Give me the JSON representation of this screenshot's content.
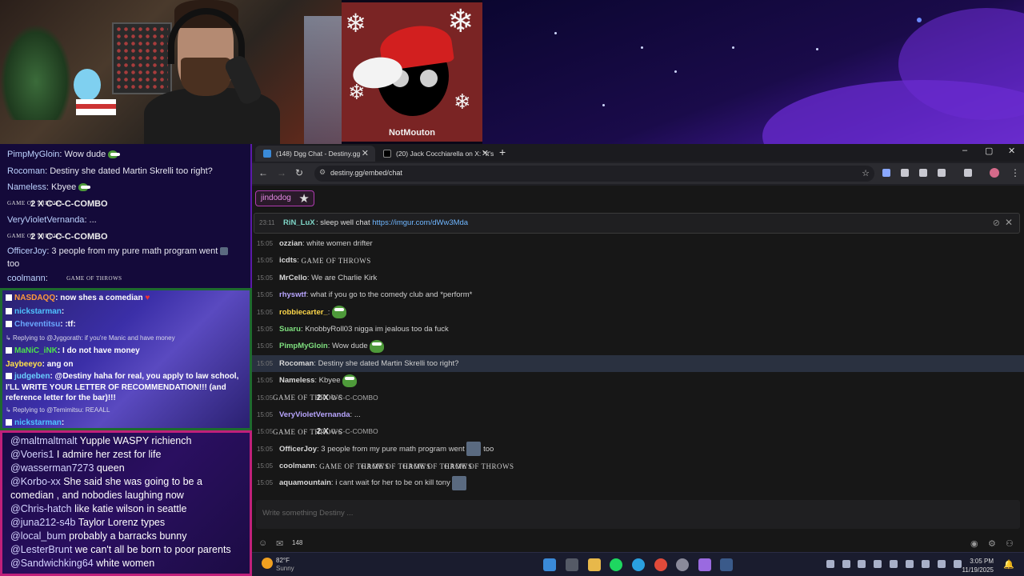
{
  "stream": {
    "xmas_label": "NotMouton"
  },
  "dgg_overlay": {
    "lines": [
      {
        "user": "PimpMyGloin",
        "text": ": Wow dude"
      },
      {
        "user": "Rocoman",
        "text": ": Destiny she dated Martin Skrelli too right?"
      },
      {
        "user": "Nameless",
        "text": ": Kbyee"
      },
      {
        "combo": "2 X C-C-C-COMBO"
      },
      {
        "user": "VeryVioletVernanda",
        "text": ": ..."
      },
      {
        "combo": "2 X C-C-C-COMBO"
      },
      {
        "user": "OfficerJoy",
        "text": ": 3 people from my pure math program went",
        "tail": "too"
      },
      {
        "user": "coolmann",
        "text": ":"
      }
    ],
    "got_emote": "GAME OF THROWS"
  },
  "twitch_overlay": {
    "lines": [
      {
        "user": "NASDAQQ",
        "text": ": now shes a comedian",
        "color": "#ff9a3a"
      },
      {
        "user": "nickstarman",
        "text": ":",
        "color": "#4fc3ff"
      },
      {
        "user": "Cheventitsu",
        "text": ": :tf:",
        "color": "#6aa8ff"
      },
      {
        "reply": "Replying to @Jyggorath: if you're Manic and have money"
      },
      {
        "user": "MaNiC_iNK",
        "text": ": I do not have money",
        "color": "#4ce04c"
      },
      {
        "user": "Jaybeeyo",
        "text": ": ang on",
        "color": "#ffe04a"
      },
      {
        "user": "judgeben",
        "text": ": @Destiny haha for real, you apply to law school, I'LL WRITE YOUR LETTER OF RECOMMENDATION!!! (and reference letter for the bar)!!!",
        "color": "#6ad0ff"
      },
      {
        "reply": "Replying to @Temimitsu: REAALL"
      },
      {
        "user": "nickstarman",
        "text": ":",
        "color": "#4fc3ff"
      }
    ]
  },
  "yt_overlay": {
    "lines": [
      {
        "user": "@maltmaltmalt",
        "text": "Yupple WASPY richiench"
      },
      {
        "user": "@Voeris1",
        "text": "I admire her zest for life"
      },
      {
        "user": "@wasserman7273",
        "text": "queen"
      },
      {
        "user": "@Korbo-xx",
        "text": "She said she was going to be a"
      },
      {
        "user": "",
        "text": "comedian , and nobodies laughing now"
      },
      {
        "user": "@Chris-hatch",
        "text": "like katie wilson in seattle"
      },
      {
        "user": "@juna212-s4b",
        "text": "Taylor Lorenz types"
      },
      {
        "user": "@local_bum",
        "text": "probably a barracks bunny"
      },
      {
        "user": "@LesterBrunt",
        "text": "we can't all be born to poor parents"
      },
      {
        "user": "@Sandwichking64",
        "text": "white women"
      }
    ]
  },
  "browser": {
    "tabs": [
      {
        "label": "(148) Dgg Chat - Destiny.gg",
        "active": true
      },
      {
        "label": "(20) Jack Cocchiarella on X: \"It's",
        "active": false
      }
    ],
    "url": "destiny.gg/embed/chat",
    "new_tab": "+",
    "window_controls": {
      "minimize": "–",
      "maximize": "▢",
      "close": "✕"
    }
  },
  "chat": {
    "user_chip": "jindodog",
    "pinned": {
      "time": "23:11",
      "user": "RiN_LuX",
      "text": ": sleep well chat ",
      "link": "https://imgur.com/dWw3Mda"
    },
    "messages": [
      {
        "time": "15:05",
        "user": "ozzian",
        "color": "#d8d8d8",
        "text": ": white women drifter"
      },
      {
        "time": "15:05",
        "user": "icdts",
        "color": "#d8d8d8",
        "text": ":",
        "emote": "got"
      },
      {
        "time": "15:05",
        "user": "MrCello",
        "color": "#d8d8d8",
        "text": ": We are Charlie Kirk"
      },
      {
        "time": "15:05",
        "user": "rhyswtf",
        "color": "#b9a6ff",
        "text": ": what if you go to the comedy club and *perform*"
      },
      {
        "time": "15:05",
        "user": "robbiecarter_",
        "color": "#ffd84a",
        "text": ":",
        "emote": "pepe"
      },
      {
        "time": "15:05",
        "user": "Suaru",
        "color": "#7fe07f",
        "text": ": KnobbyRoll03 nigga im jealous too da fuck"
      },
      {
        "time": "15:05",
        "user": "PimpMyGloin",
        "color": "#7fe07f",
        "text": ": Wow dude",
        "emote": "pepe"
      },
      {
        "time": "15:05",
        "user": "Rocoman",
        "color": "#d8d8d8",
        "text": ": Destiny she dated Martin Skrelli too right?",
        "highlight": true
      },
      {
        "time": "15:05",
        "user": "Nameless",
        "color": "#d8d8d8",
        "text": ": Kbyee",
        "emote": "pepe"
      },
      {
        "time": "15:05",
        "combo": true,
        "count": "2",
        "label": "X",
        "cc": "C-C-C-COMBO"
      },
      {
        "time": "15:05",
        "user": "VeryVioletVernanda",
        "color": "#b9a6ff",
        "text": ": ..."
      },
      {
        "time": "15:05",
        "combo": true,
        "count": "2",
        "label": "X",
        "cc": "C-C-C-COMBO"
      },
      {
        "time": "15:05",
        "user": "OfficerJoy",
        "color": "#d8d8d8",
        "text": ": 3 people from my pure math program went",
        "emote": "pic",
        "tail": "too"
      },
      {
        "time": "15:05",
        "user": "coolmann",
        "color": "#d8d8d8",
        "text": ":",
        "emote": "got4"
      },
      {
        "time": "15:05",
        "user": "aquamountain",
        "color": "#d8d8d8",
        "text": ": i cant wait for her to be on kill tony",
        "emote": "pic"
      }
    ],
    "input_placeholder": "Write something Destiny ...",
    "user_count": "148"
  },
  "taskbar": {
    "temp": "82°F",
    "condition": "Sunny",
    "time": "3:05 PM",
    "date": "11/19/2025"
  }
}
